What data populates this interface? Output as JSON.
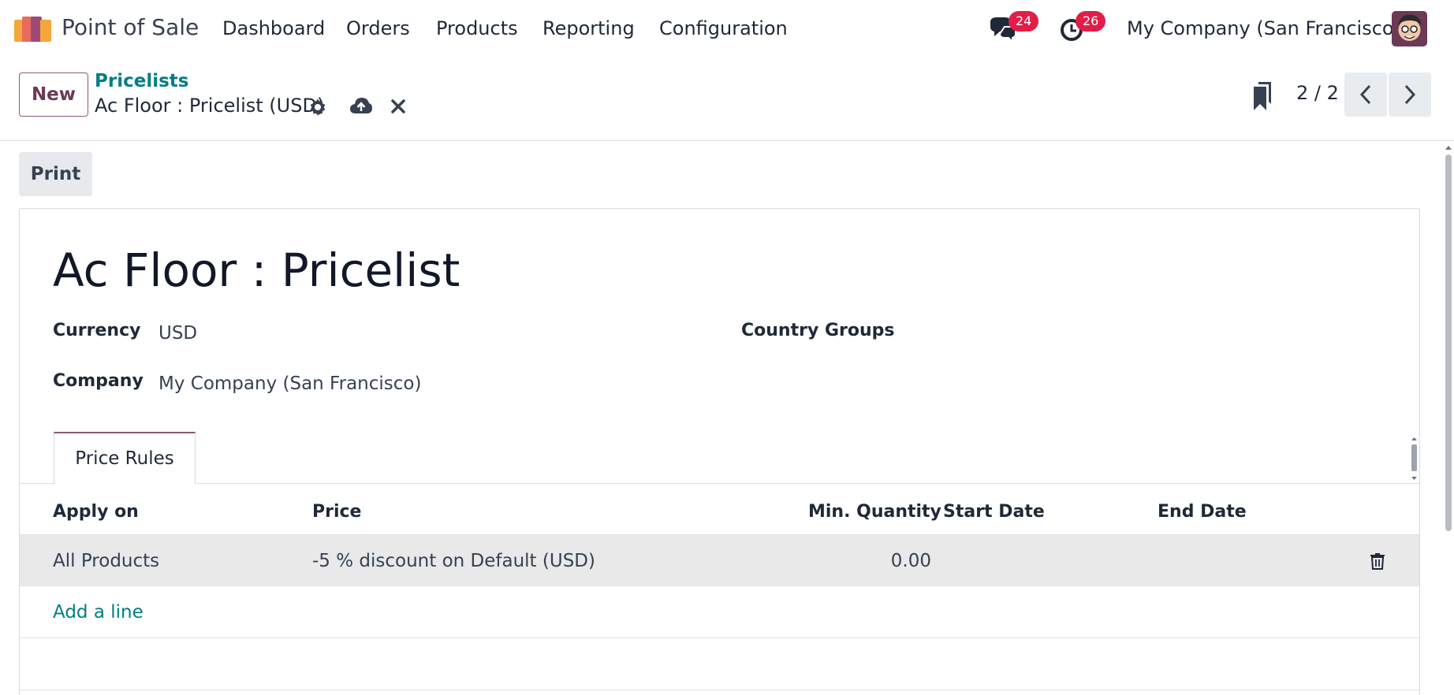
{
  "navbar": {
    "app_name": "Point of Sale",
    "menu": [
      "Dashboard",
      "Orders",
      "Products",
      "Reporting",
      "Configuration"
    ],
    "messages_count": "24",
    "activities_count": "26",
    "company": "My Company (San Francisco)"
  },
  "control_panel": {
    "new_label": "New",
    "breadcrumb": "Pricelists",
    "record_name": "Ac Floor : Pricelist (USD)",
    "pager": "2 / 2"
  },
  "actions": {
    "print_label": "Print"
  },
  "form": {
    "title": "Ac Floor : Pricelist",
    "currency_label": "Currency",
    "currency_value": "USD",
    "company_label": "Company",
    "company_value": "My Company (San Francisco)",
    "country_groups_label": "Country Groups"
  },
  "tabs": {
    "price_rules": "Price Rules"
  },
  "table": {
    "headers": [
      "Apply on",
      "Price",
      "Min. Quantity",
      "Start Date",
      "End Date"
    ],
    "rows": [
      {
        "apply_on": "All Products",
        "price": "-5 % discount on Default (USD)",
        "min_qty": "0.00",
        "start_date": "",
        "end_date": ""
      }
    ],
    "add_line": "Add a line"
  },
  "colors": {
    "brand_primary": "#714b67",
    "link_teal": "#017e84",
    "badge_red": "#e11d48"
  }
}
